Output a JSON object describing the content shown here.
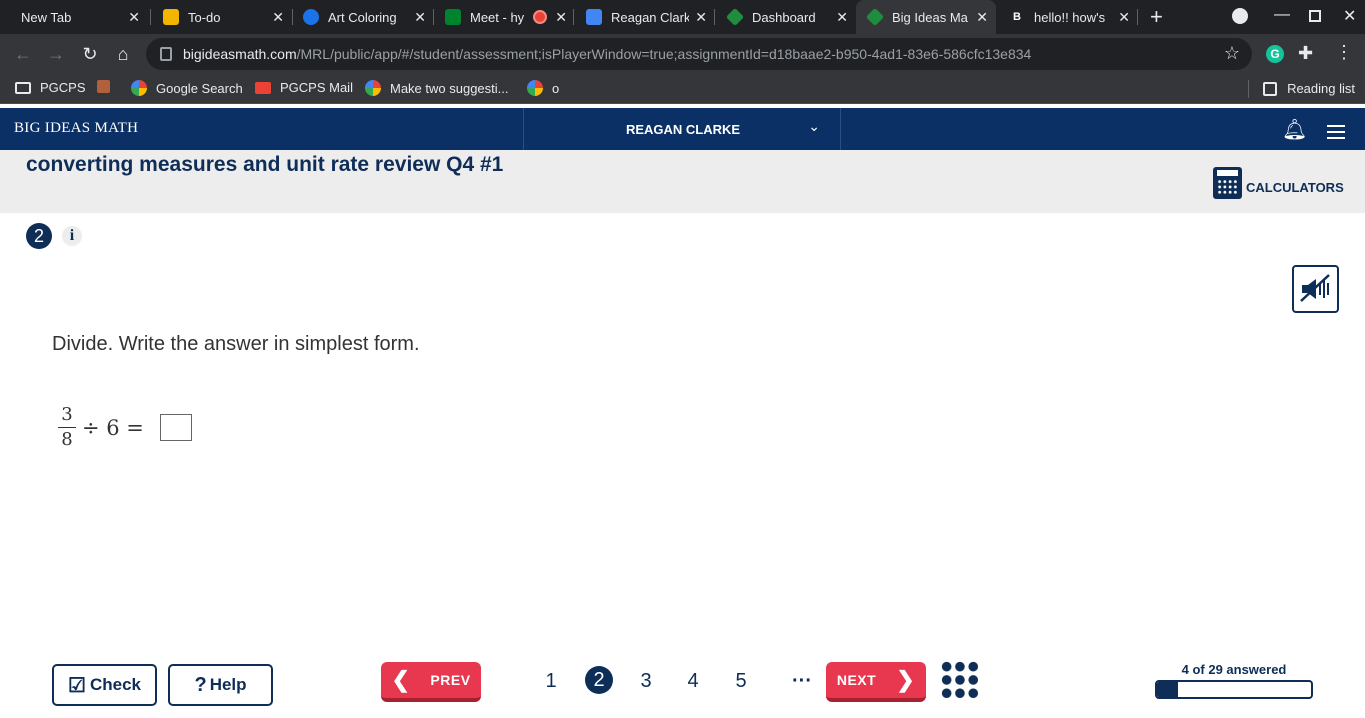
{
  "browser": {
    "tabs": [
      {
        "title": "New Tab",
        "favicon_color": "#202124",
        "active": false
      },
      {
        "title": "To-do",
        "favicon_color": "#f2b600",
        "active": false
      },
      {
        "title": "Art Coloring |",
        "favicon_color": "#1a73e8",
        "active": false
      },
      {
        "title": "Meet - hy",
        "favicon_color": "#00832d",
        "active": false
      },
      {
        "title": "Reagan Clark",
        "favicon_color": "#4285f4",
        "active": false
      },
      {
        "title": "Dashboard",
        "favicon_color": "#1e8e3e",
        "active": false
      },
      {
        "title": "Big Ideas Ma",
        "favicon_color": "#1e8e3e",
        "active": true
      },
      {
        "title": "hello!! how's",
        "favicon_color": "#202124",
        "active": false
      }
    ],
    "url_host": "bigideasmath.com",
    "url_path": "/MRL/public/app/#/student/assessment;isPlayerWindow=true;assignmentId=d18baae2-b950-4ad1-83e6-586cfc13e834",
    "bookmarks": [
      "PGCPS",
      "Google Search",
      "PGCPS Mail",
      "Make two suggesti...",
      "o"
    ],
    "reading_list": "Reading list"
  },
  "app": {
    "brand": "BIG IDEAS MATH",
    "user": "REAGAN CLARKE",
    "assignment_title": "converting measures and unit rate review Q4 #1",
    "calculators_label": "CALCULATORS",
    "accent_color": "#0e2d57",
    "button_red": "#e8384f"
  },
  "question": {
    "number": "2",
    "info": "i",
    "prompt": "Divide. Write the answer in simplest form.",
    "numerator": "3",
    "denominator": "8",
    "operator": "÷ 6 =",
    "answer": ""
  },
  "footer": {
    "check_label": "Check",
    "help_label": "Help",
    "prev_label": "PREV",
    "next_label": "NEXT",
    "pages": [
      "1",
      "2",
      "3",
      "4",
      "5"
    ],
    "current_page": "2",
    "more": "···",
    "answered_text": "4 of 29 answered",
    "answered_fraction": 0.138
  }
}
